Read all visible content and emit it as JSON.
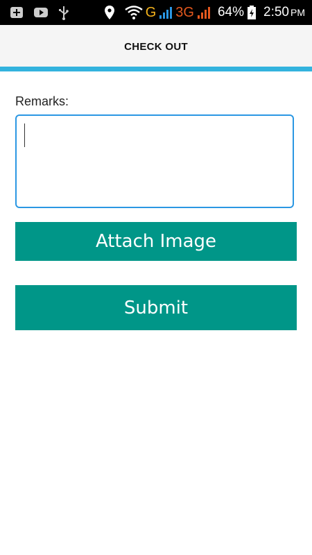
{
  "status_bar": {
    "signal_g": "G",
    "signal_3g": "3G",
    "battery": "64%",
    "time": "2:50",
    "time_suffix": "PM",
    "icons": [
      "notification-plus-icon",
      "youtube-icon",
      "usb-icon",
      "location-icon",
      "wifi-icon",
      "signal-icon",
      "battery-charging-icon"
    ]
  },
  "header": {
    "title": "CHECK OUT"
  },
  "form": {
    "remarks_label": "Remarks:",
    "remarks_value": "",
    "attach_label": "Attach Image",
    "submit_label": "Submit"
  },
  "colors": {
    "accent_bar": "#33b3de",
    "button": "#009688",
    "input_border": "#2a97e3"
  }
}
